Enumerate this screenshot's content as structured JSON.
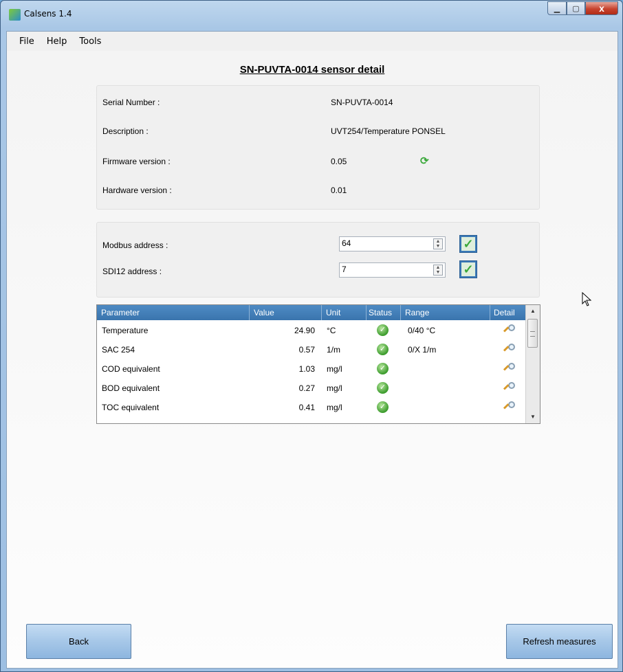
{
  "window": {
    "title": "Calsens 1.4",
    "close_glyph": "x"
  },
  "menu": [
    "File",
    "Help",
    "Tools"
  ],
  "page_title": "SN-PUVTA-0014 sensor detail",
  "info": {
    "serial_label": "Serial Number :",
    "serial_value": "SN-PUVTA-0014",
    "description_label": "Description :",
    "description_value": "UVT254/Temperature PONSEL",
    "firmware_label": "Firmware version :",
    "firmware_value": "0.05",
    "hardware_label": "Hardware version :",
    "hardware_value": "0.01"
  },
  "addresses": {
    "modbus_label": "Modbus address :",
    "modbus_value": "64",
    "sdi12_label": "SDI12 address :",
    "sdi12_value": "7"
  },
  "table": {
    "headers": [
      "Parameter",
      "Value",
      "Unit",
      "Status",
      "Range",
      "Detail"
    ],
    "rows": [
      {
        "parameter": "Temperature",
        "value": "24.90",
        "unit": "°C",
        "range": "0/40 °C"
      },
      {
        "parameter": "SAC 254",
        "value": "0.57",
        "unit": "1/m",
        "range": "0/X 1/m"
      },
      {
        "parameter": "COD equivalent",
        "value": "1.03",
        "unit": "mg/l",
        "range": ""
      },
      {
        "parameter": "BOD equivalent",
        "value": "0.27",
        "unit": "mg/l",
        "range": ""
      },
      {
        "parameter": "TOC equivalent",
        "value": "0.41",
        "unit": "mg/l",
        "range": ""
      }
    ]
  },
  "buttons": {
    "back": "Back",
    "refresh": "Refresh measures"
  },
  "icons": {
    "status": "check-circle-icon",
    "detail": "magnifier-icon",
    "firmware": "refresh-icon"
  }
}
